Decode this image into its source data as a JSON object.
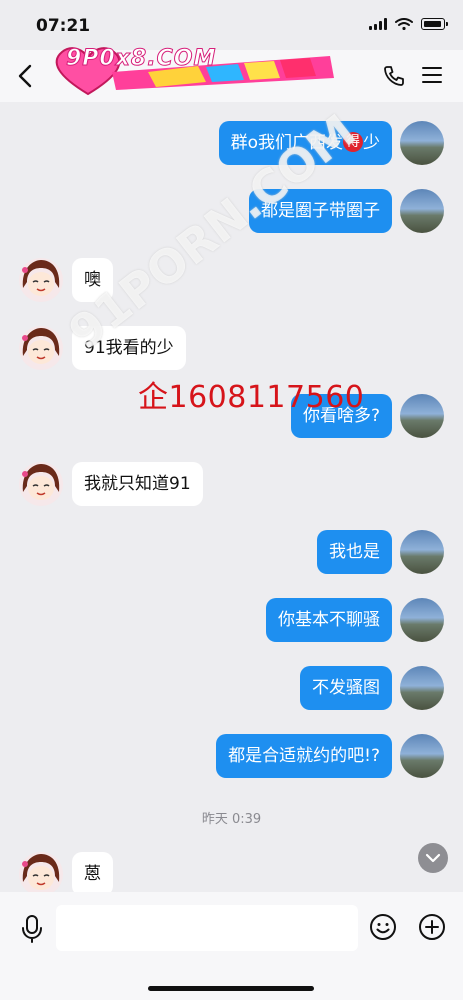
{
  "status_bar": {
    "time": "07:21"
  },
  "header": {
    "logo_text": "9P0x8.COM",
    "back_icon": "chevron-left-icon",
    "call_icon": "phone-icon",
    "menu_icon": "hamburger-menu-icon"
  },
  "messages": [
    {
      "from": "me",
      "text_before": "群o我们广西发",
      "badge": "得",
      "text_after": "少"
    },
    {
      "from": "me",
      "text": "都是圈子带圈子"
    },
    {
      "from": "other",
      "text": "噢"
    },
    {
      "from": "other",
      "text": "91我看的少"
    },
    {
      "from": "me",
      "text": "你看啥多?"
    },
    {
      "from": "other",
      "text": "我就只知道91"
    },
    {
      "from": "me",
      "text": "我也是"
    },
    {
      "from": "me",
      "text": "你基本不聊骚"
    },
    {
      "from": "me",
      "text": "不发骚图"
    },
    {
      "from": "me",
      "text": "都是合适就约的吧!?"
    },
    {
      "from": "other",
      "text": "蒽"
    }
  ],
  "timestamp": "昨天 0:39",
  "overlay_watermark": "企1608117560",
  "diagonal_watermark": "91PORN.COM",
  "input": {
    "value": "",
    "placeholder": ""
  },
  "colors": {
    "my_bubble": "#1e8ff0",
    "other_bubble": "#ffffff",
    "background": "#ededf0",
    "watermark": "#d6141a"
  }
}
